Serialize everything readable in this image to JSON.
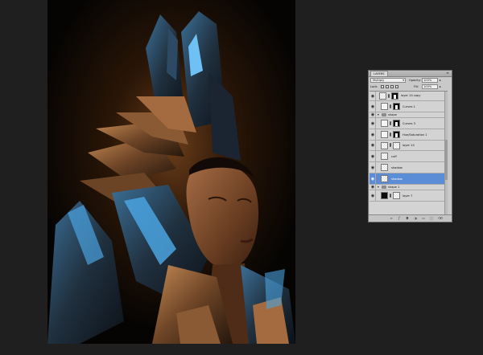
{
  "panel": {
    "tab_label": "LAYERS",
    "menu_glyph": "≡",
    "blend_mode": "Multiply",
    "opacity_label": "Opacity:",
    "opacity_value": "100%",
    "lock_label": "Lock:",
    "fill_label": "Fill:",
    "fill_value": "100%",
    "layers": [
      {
        "name": "layer 14 copy",
        "type": "pixel-mask"
      },
      {
        "name": "Curves 1",
        "type": "adjustment"
      },
      {
        "name": "shape",
        "type": "group"
      },
      {
        "name": "Curves 3",
        "type": "adjustment"
      },
      {
        "name": "Hue/Saturation 1",
        "type": "adjustment"
      },
      {
        "name": "layer 10",
        "type": "pixel"
      },
      {
        "name": "cuff",
        "type": "pixel"
      },
      {
        "name": "shadow",
        "type": "pixel"
      },
      {
        "name": "shadow",
        "type": "pixel",
        "selected": true
      },
      {
        "name": "shape 1",
        "type": "group"
      },
      {
        "name": "layer 7",
        "type": "pixel"
      }
    ],
    "footer_icons": [
      "link-icon",
      "fx-icon",
      "mask-icon",
      "adjustment-icon",
      "folder-icon",
      "new-layer-icon",
      "trash-icon"
    ]
  },
  "colors": {
    "background": "#1f1f1f",
    "selection": "#5b8dd6",
    "accent_blue": "#4aa3e0",
    "bronze": "#8a5a34"
  }
}
